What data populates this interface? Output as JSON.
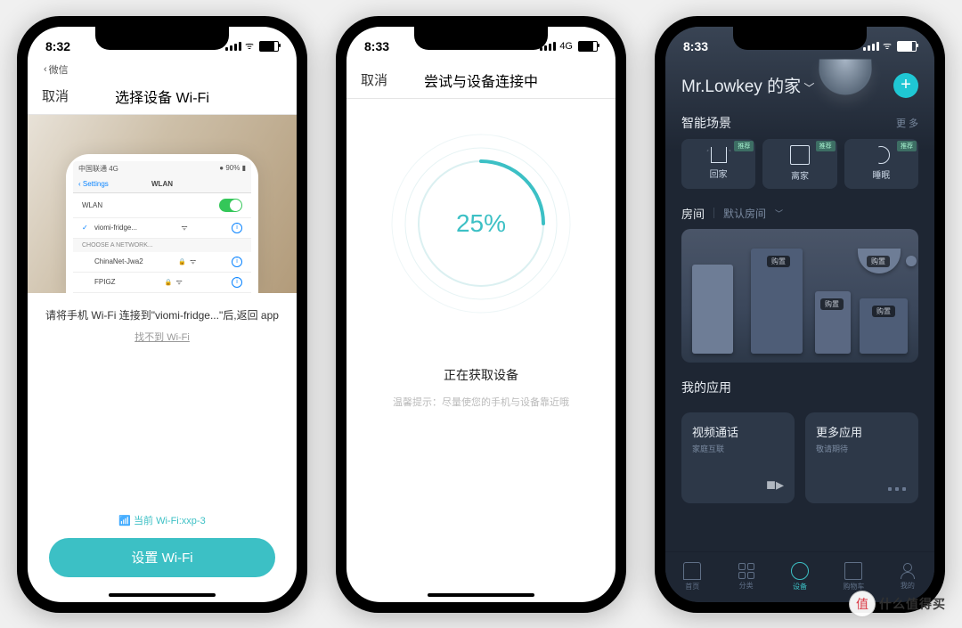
{
  "watermark": "什么值得买",
  "phone1": {
    "time": "8:32",
    "back_crumb": "微信",
    "nav_cancel": "取消",
    "nav_title": "选择设备 Wi-Fi",
    "inner": {
      "carrier": "中国联通  4G",
      "battery": "90%",
      "back": "Settings",
      "title": "WLAN",
      "wlan_label": "WLAN",
      "connected": "viomi-fridge...",
      "choose": "CHOOSE A NETWORK...",
      "net1": "ChinaNet-Jwa2",
      "net2": "FPIGZ"
    },
    "instruction": "请将手机 Wi-Fi 连接到\"viomi-fridge...\"后,返回 app",
    "not_found": "找不到 Wi-Fi",
    "current_wifi": "当前 Wi-Fi:xxp-3",
    "button": "设置 Wi-Fi"
  },
  "phone2": {
    "time": "8:33",
    "net": "4G",
    "nav_cancel": "取消",
    "nav_title": "尝试与设备连接中",
    "percent": "25%",
    "status": "正在获取设备",
    "hint": "温馨提示：尽量使您的手机与设备靠近哦"
  },
  "phone3": {
    "time": "8:33",
    "home_name": "Mr.Lowkey 的家",
    "sec_scene": "智能场景",
    "more": "更 多",
    "scene_tag": "推荐",
    "scene1": "回家",
    "scene2": "离家",
    "scene3": "睡眠",
    "room_label": "房间",
    "room_default": "默认房间",
    "buy": "购置",
    "sec_apps": "我的应用",
    "app1_t": "视频通话",
    "app1_s": "家庭互联",
    "app2_t": "更多应用",
    "app2_s": "敬请期待",
    "tab1": "首页",
    "tab2": "分类",
    "tab3": "设备",
    "tab4": "购物车",
    "tab5": "我的"
  }
}
